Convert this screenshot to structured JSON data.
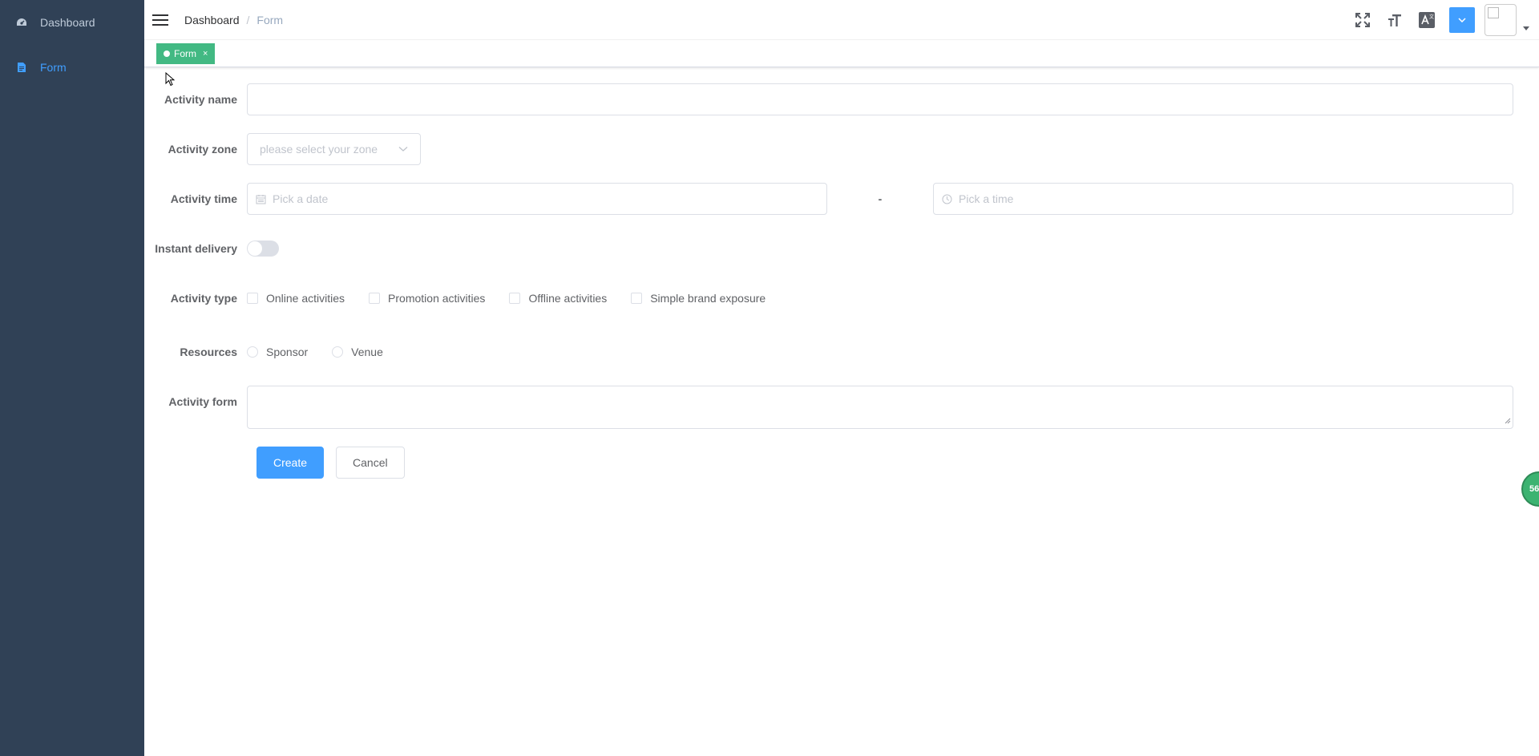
{
  "sidebar": {
    "items": [
      {
        "label": "Dashboard",
        "icon": "dashboard-icon",
        "active": false
      },
      {
        "label": "Form",
        "icon": "document-icon",
        "active": true
      }
    ]
  },
  "navbar": {
    "breadcrumb": {
      "home": "Dashboard",
      "separator": "/",
      "current": "Form"
    }
  },
  "tags": [
    {
      "label": "Form",
      "close": "×",
      "active": true
    }
  ],
  "form": {
    "name_label": "Activity name",
    "name_value": "",
    "zone_label": "Activity zone",
    "zone_placeholder": "please select your zone",
    "time_label": "Activity time",
    "date_placeholder": "Pick a date",
    "time_separator": "-",
    "time_placeholder": "Pick a time",
    "delivery_label": "Instant delivery",
    "delivery_on": false,
    "type_label": "Activity type",
    "types": [
      "Online activities",
      "Promotion activities",
      "Offline activities",
      "Simple brand exposure"
    ],
    "resources_label": "Resources",
    "resources": [
      "Sponsor",
      "Venue"
    ],
    "desc_label": "Activity form",
    "create_label": "Create",
    "cancel_label": "Cancel"
  },
  "floating_badge": "56",
  "colors": {
    "sidebar_bg": "#304156",
    "accent": "#409eff",
    "tag_active": "#42b983"
  }
}
